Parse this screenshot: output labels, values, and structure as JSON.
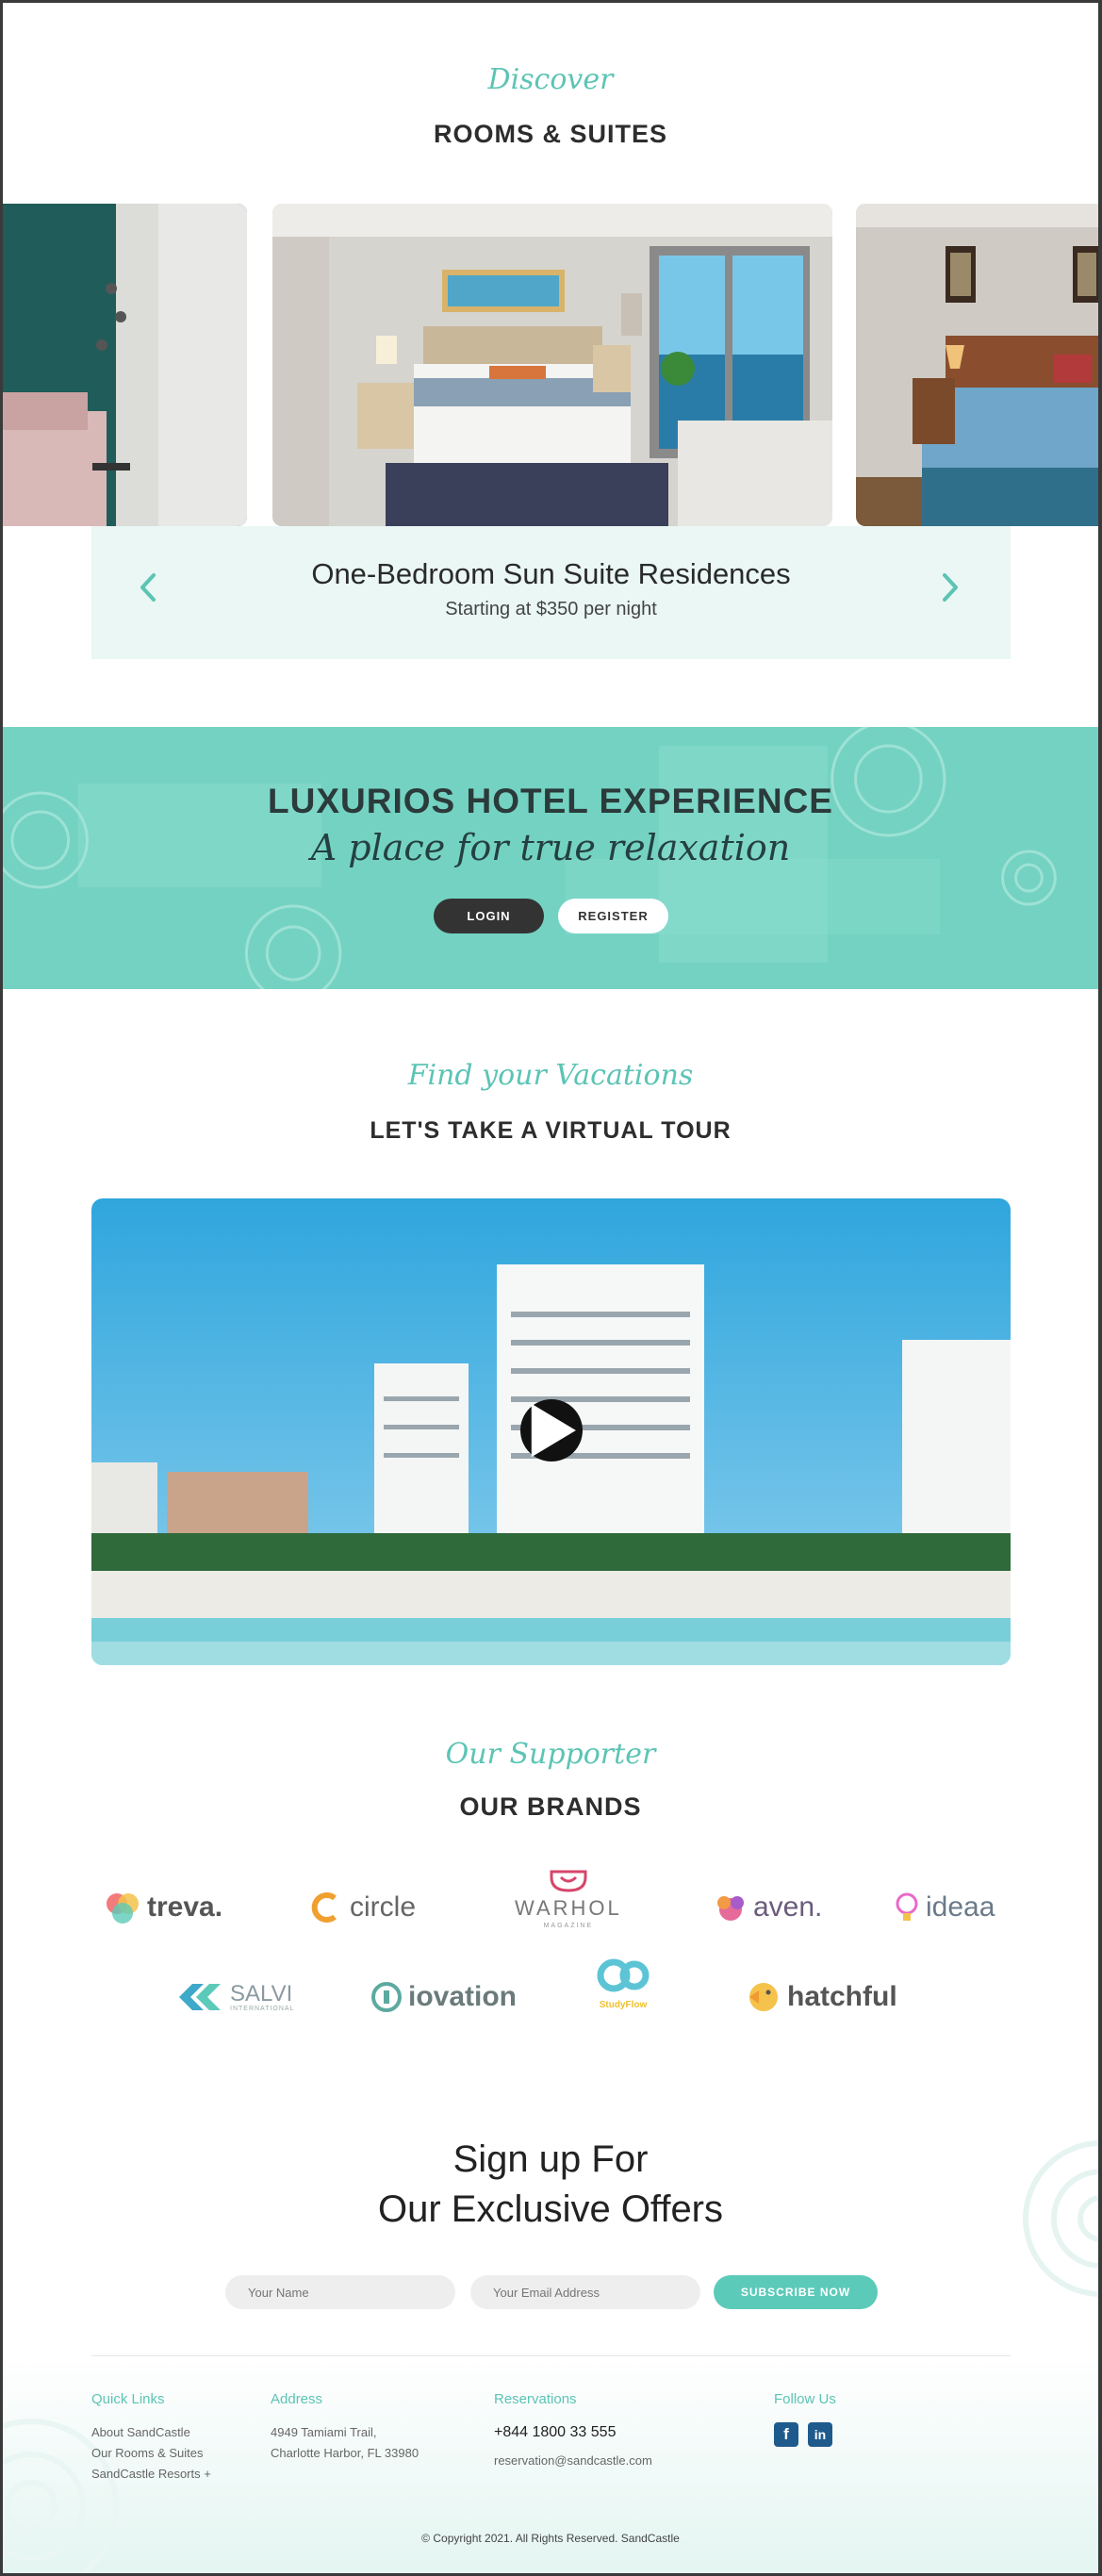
{
  "rooms": {
    "script_title": "Discover",
    "heading": "ROOMS & SUITES",
    "current_room_name": "One-Bedroom Sun Suite Residences",
    "current_room_price": "Starting at $350 per night"
  },
  "banner": {
    "title": "LUXURIOS HOTEL EXPERIENCE",
    "subtitle": "A place for true relaxation",
    "login_label": "LOGIN",
    "register_label": "REGISTER"
  },
  "tour": {
    "script_title": "Find your Vacations",
    "heading": "LET'S TAKE A VIRTUAL TOUR"
  },
  "brands": {
    "script_title": "Our Supporter",
    "heading": "OUR BRANDS",
    "items": [
      {
        "name": "treva.",
        "icon": "treva-logo-icon",
        "color": "#555555"
      },
      {
        "name": "circle",
        "icon": "circle-logo-icon",
        "color": "#666666"
      },
      {
        "name": "WARHOL",
        "tagline": "MAGAZINE",
        "icon": "warhol-logo-icon",
        "color": "#777777"
      },
      {
        "name": "aven.",
        "icon": "aven-logo-icon",
        "color": "#6b5b7b"
      },
      {
        "name": "ideaa",
        "icon": "lightbulb-logo-icon",
        "color": "#6b7a8a"
      },
      {
        "name": "SALVI",
        "tagline": "INTERNATIONAL",
        "icon": "salvi-logo-icon",
        "color": "#8a9aa0"
      },
      {
        "name": "iovation",
        "icon": "iovation-logo-icon",
        "color": "#6b7a7a"
      },
      {
        "name": "StudyFlow",
        "icon": "go-logo-icon",
        "color": "#5cc4d5"
      },
      {
        "name": "hatchful",
        "icon": "hatchful-logo-icon",
        "color": "#555555"
      }
    ]
  },
  "signup": {
    "line1": "Sign up For",
    "line2": "Our Exclusive Offers",
    "name_placeholder": "Your Name",
    "email_placeholder": "Your Email Address",
    "subscribe_label": "SUBSCRIBE NOW"
  },
  "footer": {
    "quick_links": {
      "heading": "Quick Links",
      "items": [
        "About SandCastle",
        "Our Rooms & Suites",
        "SandCastle Resorts +"
      ]
    },
    "address": {
      "heading": "Address",
      "line1": "4949 Tamiami Trail,",
      "line2": "Charlotte Harbor, FL 33980"
    },
    "reservations": {
      "heading": "Reservations",
      "phone": "+844 1800 33 555",
      "email": "reservation@sandcastle.com"
    },
    "follow": {
      "heading": "Follow Us",
      "facebook": "f",
      "linkedin": "in"
    },
    "copyright": "© Copyright 2021. All Rights Reserved. SandCastle"
  },
  "colors": {
    "accent": "#5cc4b5",
    "banner": "#74d2c2",
    "dark": "#333333"
  }
}
